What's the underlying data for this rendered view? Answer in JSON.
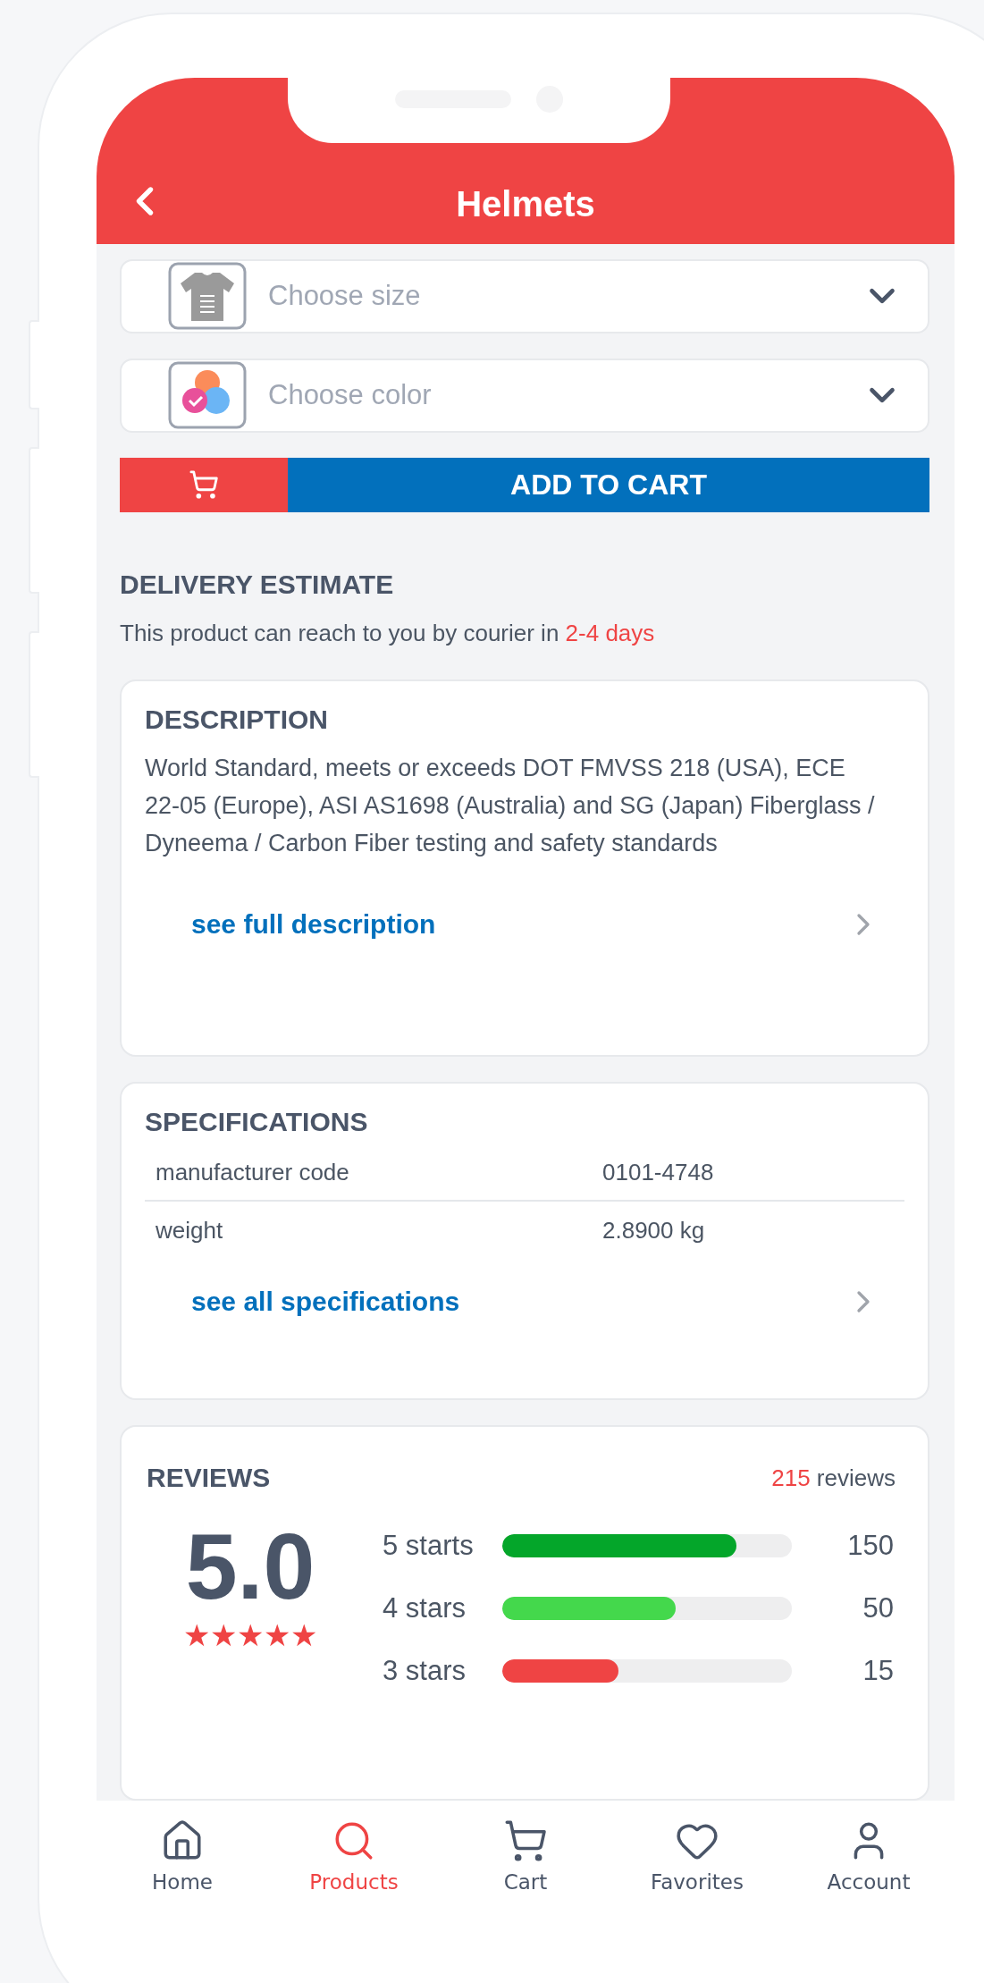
{
  "header": {
    "title": "Helmets"
  },
  "selectors": [
    {
      "kind": "size",
      "placeholder": "Choose size"
    },
    {
      "kind": "color",
      "placeholder": "Choose color"
    }
  ],
  "add_to_cart": {
    "label": "ADD TO CART"
  },
  "delivery": {
    "title": "DELIVERY ESTIMATE",
    "text": "This product can reach to you by courier in",
    "highlight": "2-4 days"
  },
  "description": {
    "title": "DESCRIPTION",
    "text": "World Standard, meets or exceeds DOT FMVSS 218 (USA), ECE 22-05 (Europe), ASI AS1698 (Australia) and SG (Japan) Fiberglass / Dyneema / Carbon Fiber testing and safety standards",
    "link": "see full description"
  },
  "specifications": {
    "title": "SPECIFICATIONS",
    "rows": [
      {
        "name": "manufacturer code",
        "value": "0101-4748"
      },
      {
        "name": "weight",
        "value": "2.8900 kg"
      }
    ],
    "link": "see all specifications"
  },
  "reviews": {
    "title": "REVIEWS",
    "count": "215",
    "count_label": "reviews",
    "rating": "5.0",
    "stars": 5,
    "breakdown": [
      {
        "label": "5 starts",
        "level": 0.81,
        "count": "150",
        "color": "#04a62a"
      },
      {
        "label": "4 stars",
        "level": 0.6,
        "count": "50",
        "color": "#44d84c"
      },
      {
        "label": "3 stars",
        "level": 0.4,
        "count": "15",
        "color": "#ef4444"
      }
    ]
  },
  "nav": [
    {
      "label": "Home",
      "kind": "home",
      "selected": false
    },
    {
      "label": "Products",
      "kind": "search",
      "selected": true
    },
    {
      "label": "Cart",
      "kind": "cart",
      "selected": false
    },
    {
      "label": "Favorites",
      "kind": "heart",
      "selected": false
    },
    {
      "label": "Account",
      "kind": "person",
      "selected": false
    }
  ]
}
